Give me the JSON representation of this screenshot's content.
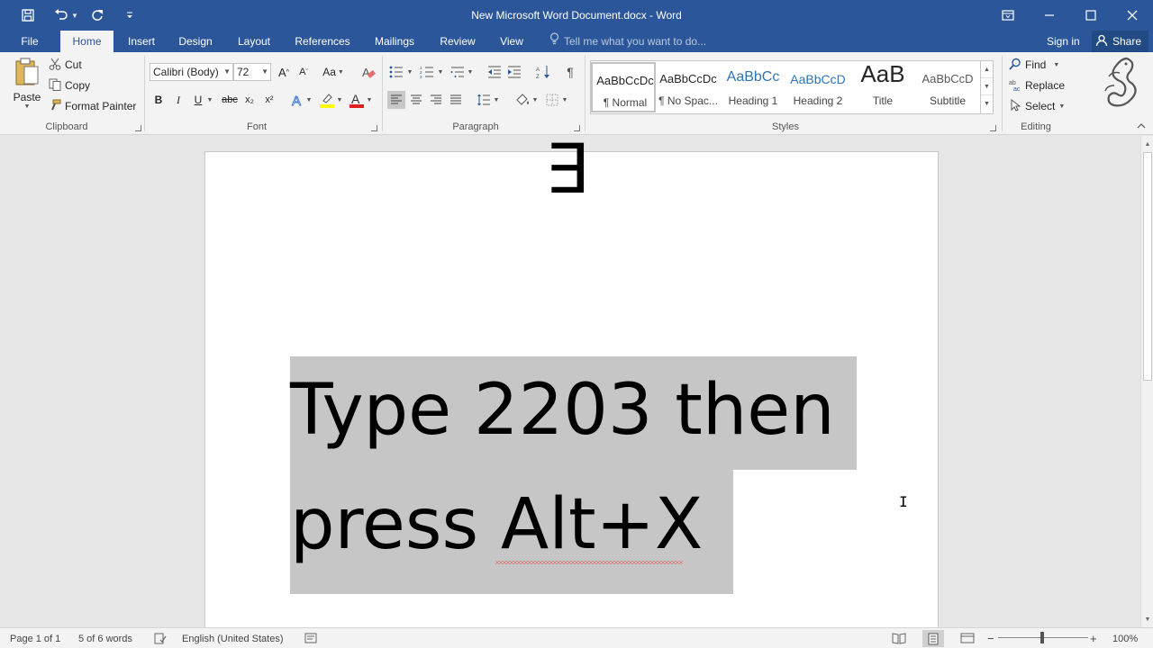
{
  "window": {
    "title": "New Microsoft Word Document.docx - Word",
    "accent": "#2b579a",
    "controls": [
      "ribbon-display-options-icon",
      "minimize-icon",
      "maximize-icon",
      "close-icon"
    ]
  },
  "tabs": {
    "file": "File",
    "home": "Home",
    "insert": "Insert",
    "design": "Design",
    "layout": "Layout",
    "references": "References",
    "mailings": "Mailings",
    "review": "Review",
    "view": "View",
    "tell_me": "Tell me what you want to do...",
    "sign_in": "Sign in",
    "share": "Share"
  },
  "ribbon": {
    "clipboard": {
      "paste": "Paste",
      "cut": "Cut",
      "copy": "Copy",
      "format_painter": "Format Painter",
      "label": "Clipboard"
    },
    "font": {
      "font_name": "Calibri (Body)",
      "font_size": "72",
      "label": "Font",
      "change_case": "Aa",
      "bold": "B",
      "italic": "I",
      "underline": "U",
      "strike": "abc",
      "sub": "x₂",
      "sup": "x²"
    },
    "paragraph": {
      "label": "Paragraph"
    },
    "styles": {
      "label": "Styles",
      "items": [
        {
          "preview": "AaBbCcDc",
          "name": "¶ Normal",
          "color": "#000000"
        },
        {
          "preview": "AaBbCcDc",
          "name": "¶ No Spac...",
          "color": "#000000"
        },
        {
          "preview": "AaBbCc",
          "name": "Heading 1",
          "color": "#2e74b5"
        },
        {
          "preview": "AaBbCcD",
          "name": "Heading 2",
          "color": "#2e74b5"
        },
        {
          "preview": "AaB",
          "name": "Title",
          "color": "#000000"
        },
        {
          "preview": "AaBbCcD",
          "name": "Subtitle",
          "color": "#595959"
        }
      ]
    },
    "editing": {
      "find": "Find",
      "replace": "Replace",
      "select": "Select",
      "label": "Editing"
    }
  },
  "document": {
    "symbol": "∃",
    "line1": "Type 2203 then",
    "line2": "press Alt+X",
    "selection_color": "#c6c6c6"
  },
  "status": {
    "page": "Page 1 of 1",
    "words": "5 of 6 words",
    "language": "English (United States)",
    "zoom": "100%"
  }
}
